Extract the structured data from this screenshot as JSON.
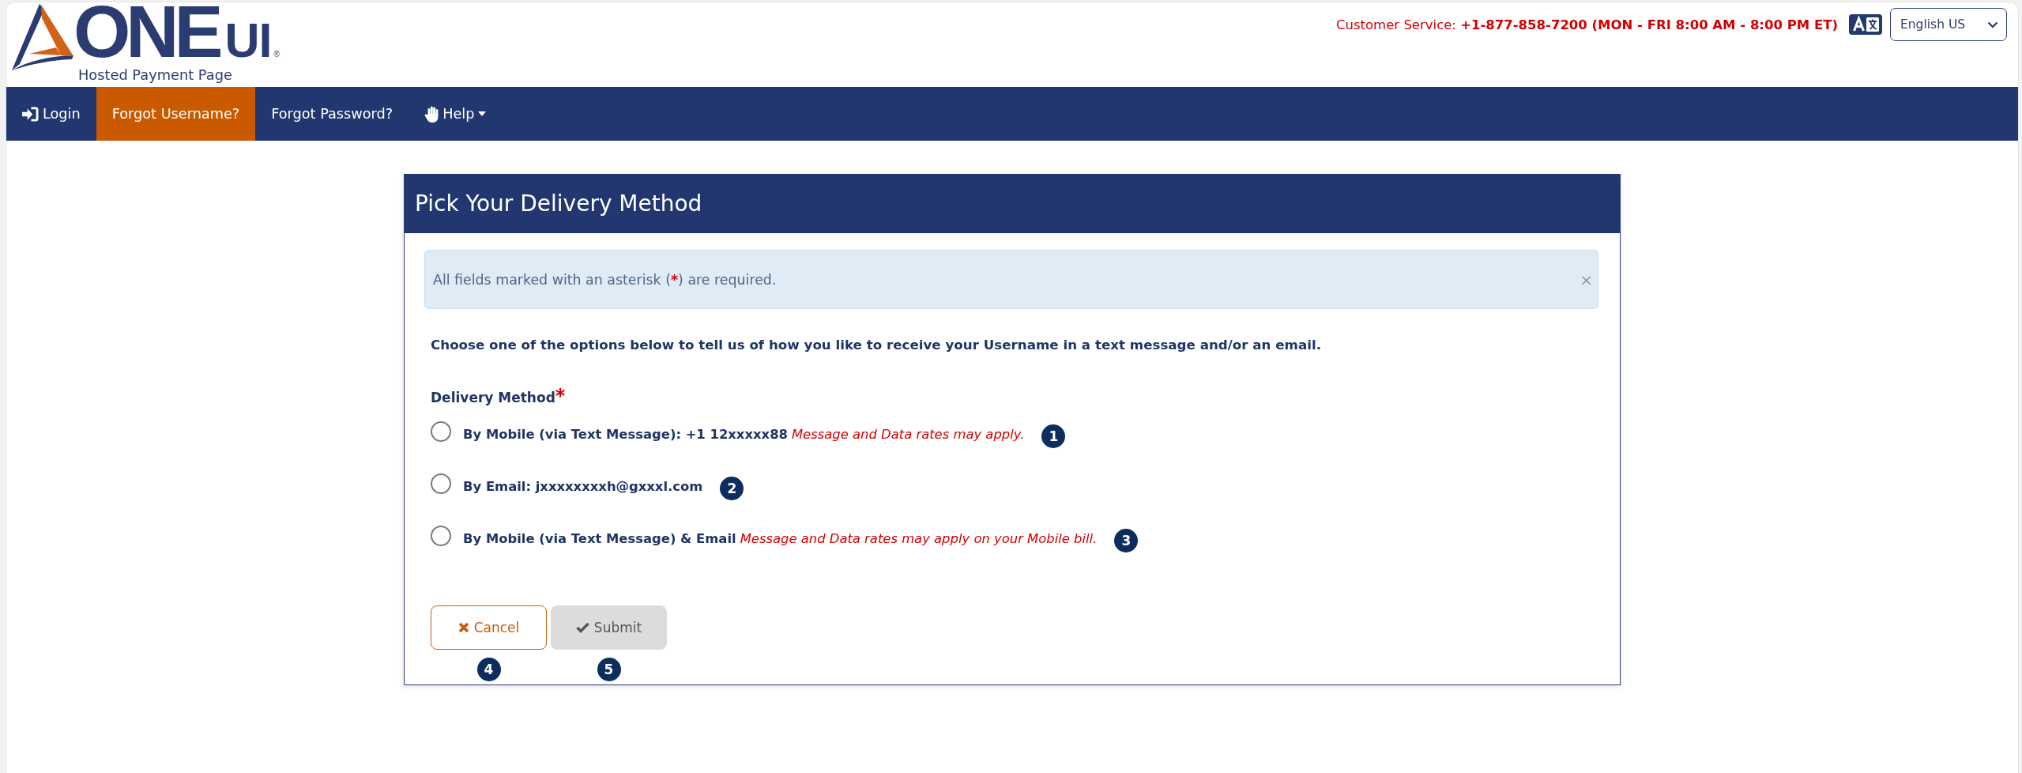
{
  "header": {
    "logo": {
      "wordmark": "ONE",
      "wordmark_suffix": "UI",
      "registered": "®",
      "tagline": "Hosted Payment Page"
    },
    "customer_service": {
      "label": "Customer Service:",
      "value": "+1-877-858-7200 (MON - FRI 8:00 AM - 8:00 PM ET)"
    },
    "language_select": {
      "value": "English US"
    }
  },
  "nav": [
    {
      "label": "Login",
      "kind": "signin",
      "selected": false
    },
    {
      "label": "Forgot Username?",
      "kind": "link",
      "selected": true
    },
    {
      "label": "Forgot Password?",
      "kind": "link",
      "selected": false
    },
    {
      "label": "Help",
      "kind": "help",
      "selected": false
    }
  ],
  "card": {
    "title": "Pick Your Delivery Method",
    "alert": {
      "text_before": "All fields marked with an asterisk (",
      "required_mark": "*",
      "text_after": ") are required.",
      "close": "×"
    },
    "instruction": "Choose one of the options below to tell us of how you like to receive your Username in a text message and/or an email.",
    "delivery": {
      "label": "Delivery Method",
      "required_mark": "*",
      "options": [
        {
          "label": "By Mobile (via Text Message): +1 12xxxxx88",
          "note": "Message and Data rates may apply.",
          "selected": false,
          "marker": "1"
        },
        {
          "label": "By Email: jxxxxxxxxh@gxxxl.com",
          "selected": false,
          "marker": "2"
        },
        {
          "label": "By Mobile (via Text Message) & Email",
          "note": "Message and Data rates may apply on your Mobile bill.",
          "selected": false,
          "marker": "3"
        }
      ]
    },
    "buttons": [
      {
        "label": "Cancel",
        "kind": "cancel",
        "disabled": false,
        "marker": "4"
      },
      {
        "label": "Submit",
        "kind": "submit",
        "disabled": true,
        "marker": "5"
      }
    ]
  }
}
